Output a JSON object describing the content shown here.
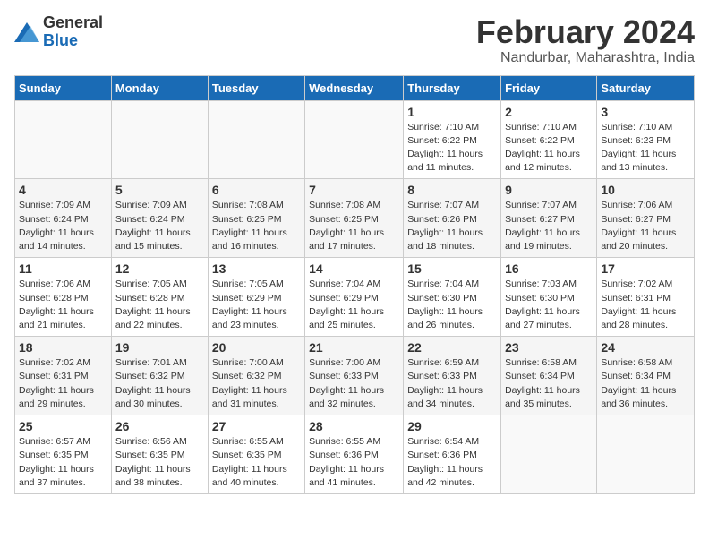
{
  "header": {
    "logo_general": "General",
    "logo_blue": "Blue",
    "month_title": "February 2024",
    "location": "Nandurbar, Maharashtra, India"
  },
  "weekdays": [
    "Sunday",
    "Monday",
    "Tuesday",
    "Wednesday",
    "Thursday",
    "Friday",
    "Saturday"
  ],
  "weeks": [
    [
      {
        "day": "",
        "info": ""
      },
      {
        "day": "",
        "info": ""
      },
      {
        "day": "",
        "info": ""
      },
      {
        "day": "",
        "info": ""
      },
      {
        "day": "1",
        "info": "Sunrise: 7:10 AM\nSunset: 6:22 PM\nDaylight: 11 hours and 11 minutes."
      },
      {
        "day": "2",
        "info": "Sunrise: 7:10 AM\nSunset: 6:22 PM\nDaylight: 11 hours and 12 minutes."
      },
      {
        "day": "3",
        "info": "Sunrise: 7:10 AM\nSunset: 6:23 PM\nDaylight: 11 hours and 13 minutes."
      }
    ],
    [
      {
        "day": "4",
        "info": "Sunrise: 7:09 AM\nSunset: 6:24 PM\nDaylight: 11 hours and 14 minutes."
      },
      {
        "day": "5",
        "info": "Sunrise: 7:09 AM\nSunset: 6:24 PM\nDaylight: 11 hours and 15 minutes."
      },
      {
        "day": "6",
        "info": "Sunrise: 7:08 AM\nSunset: 6:25 PM\nDaylight: 11 hours and 16 minutes."
      },
      {
        "day": "7",
        "info": "Sunrise: 7:08 AM\nSunset: 6:25 PM\nDaylight: 11 hours and 17 minutes."
      },
      {
        "day": "8",
        "info": "Sunrise: 7:07 AM\nSunset: 6:26 PM\nDaylight: 11 hours and 18 minutes."
      },
      {
        "day": "9",
        "info": "Sunrise: 7:07 AM\nSunset: 6:27 PM\nDaylight: 11 hours and 19 minutes."
      },
      {
        "day": "10",
        "info": "Sunrise: 7:06 AM\nSunset: 6:27 PM\nDaylight: 11 hours and 20 minutes."
      }
    ],
    [
      {
        "day": "11",
        "info": "Sunrise: 7:06 AM\nSunset: 6:28 PM\nDaylight: 11 hours and 21 minutes."
      },
      {
        "day": "12",
        "info": "Sunrise: 7:05 AM\nSunset: 6:28 PM\nDaylight: 11 hours and 22 minutes."
      },
      {
        "day": "13",
        "info": "Sunrise: 7:05 AM\nSunset: 6:29 PM\nDaylight: 11 hours and 23 minutes."
      },
      {
        "day": "14",
        "info": "Sunrise: 7:04 AM\nSunset: 6:29 PM\nDaylight: 11 hours and 25 minutes."
      },
      {
        "day": "15",
        "info": "Sunrise: 7:04 AM\nSunset: 6:30 PM\nDaylight: 11 hours and 26 minutes."
      },
      {
        "day": "16",
        "info": "Sunrise: 7:03 AM\nSunset: 6:30 PM\nDaylight: 11 hours and 27 minutes."
      },
      {
        "day": "17",
        "info": "Sunrise: 7:02 AM\nSunset: 6:31 PM\nDaylight: 11 hours and 28 minutes."
      }
    ],
    [
      {
        "day": "18",
        "info": "Sunrise: 7:02 AM\nSunset: 6:31 PM\nDaylight: 11 hours and 29 minutes."
      },
      {
        "day": "19",
        "info": "Sunrise: 7:01 AM\nSunset: 6:32 PM\nDaylight: 11 hours and 30 minutes."
      },
      {
        "day": "20",
        "info": "Sunrise: 7:00 AM\nSunset: 6:32 PM\nDaylight: 11 hours and 31 minutes."
      },
      {
        "day": "21",
        "info": "Sunrise: 7:00 AM\nSunset: 6:33 PM\nDaylight: 11 hours and 32 minutes."
      },
      {
        "day": "22",
        "info": "Sunrise: 6:59 AM\nSunset: 6:33 PM\nDaylight: 11 hours and 34 minutes."
      },
      {
        "day": "23",
        "info": "Sunrise: 6:58 AM\nSunset: 6:34 PM\nDaylight: 11 hours and 35 minutes."
      },
      {
        "day": "24",
        "info": "Sunrise: 6:58 AM\nSunset: 6:34 PM\nDaylight: 11 hours and 36 minutes."
      }
    ],
    [
      {
        "day": "25",
        "info": "Sunrise: 6:57 AM\nSunset: 6:35 PM\nDaylight: 11 hours and 37 minutes."
      },
      {
        "day": "26",
        "info": "Sunrise: 6:56 AM\nSunset: 6:35 PM\nDaylight: 11 hours and 38 minutes."
      },
      {
        "day": "27",
        "info": "Sunrise: 6:55 AM\nSunset: 6:35 PM\nDaylight: 11 hours and 40 minutes."
      },
      {
        "day": "28",
        "info": "Sunrise: 6:55 AM\nSunset: 6:36 PM\nDaylight: 11 hours and 41 minutes."
      },
      {
        "day": "29",
        "info": "Sunrise: 6:54 AM\nSunset: 6:36 PM\nDaylight: 11 hours and 42 minutes."
      },
      {
        "day": "",
        "info": ""
      },
      {
        "day": "",
        "info": ""
      }
    ]
  ]
}
